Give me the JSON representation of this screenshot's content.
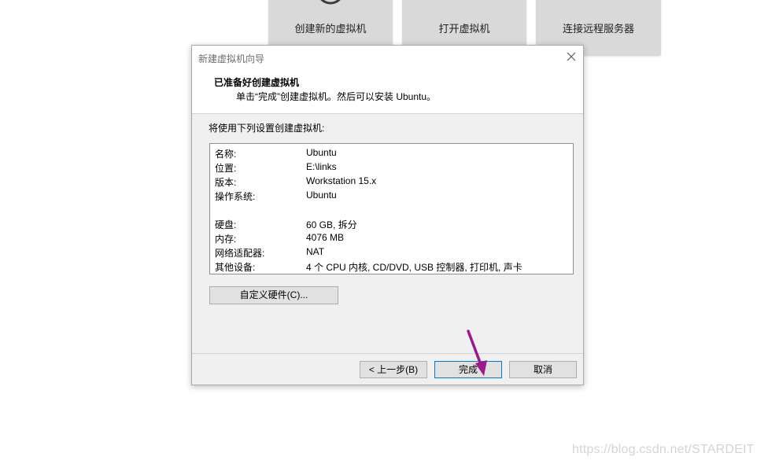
{
  "home_tiles": [
    {
      "label": "创建新的虚拟机",
      "icon": "create-vm-icon"
    },
    {
      "label": "打开虚拟机",
      "icon": "open-vm-icon"
    },
    {
      "label": "连接远程服务器",
      "icon": "remote-server-icon"
    }
  ],
  "dialog": {
    "window_title": "新建虚拟机向导",
    "header_title": "已准备好创建虚拟机",
    "header_subtitle": "单击“完成”创建虚拟机。然后可以安装 Ubuntu。",
    "intro_text": "将使用下列设置创建虚拟机:",
    "settings": [
      {
        "key": "名称:",
        "value": "Ubuntu"
      },
      {
        "key": "位置:",
        "value": "E:\\links"
      },
      {
        "key": "版本:",
        "value": "Workstation 15.x"
      },
      {
        "key": "操作系统:",
        "value": "Ubuntu"
      },
      {
        "key": "硬盘:",
        "value": "60 GB, 拆分"
      },
      {
        "key": "内存:",
        "value": "4076 MB"
      },
      {
        "key": "网络适配器:",
        "value": "NAT"
      },
      {
        "key": "其他设备:",
        "value": "4 个 CPU 内核, CD/DVD, USB 控制器, 打印机, 声卡"
      }
    ],
    "customize_button": "自定义硬件(C)...",
    "back_button": "< 上一步(B)",
    "finish_button": "完成",
    "cancel_button": "取消"
  },
  "watermark": "https://blog.csdn.net/STARDEIT",
  "colors": {
    "annotation_arrow": "#9c1a8c",
    "dialog_bg": "#f0f0f0",
    "tile_bg": "#d9d9d9",
    "default_button_border": "#0078d7"
  }
}
